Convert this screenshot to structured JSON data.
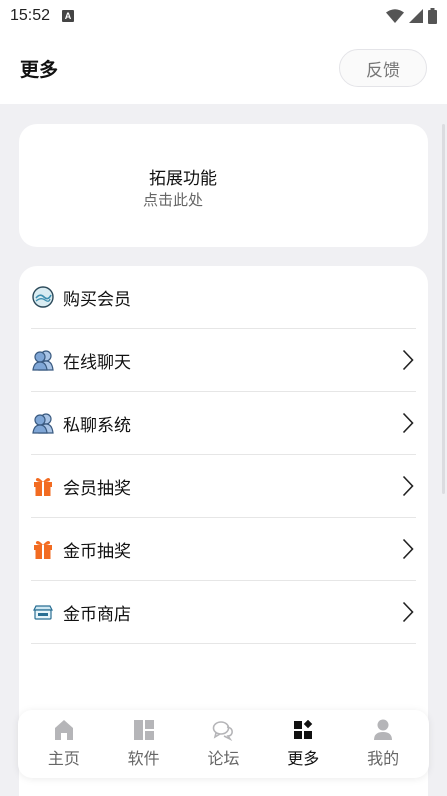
{
  "status_bar": {
    "time": "15:52",
    "notification_glyph": "A"
  },
  "header": {
    "title": "更多",
    "feedback_label": "反馈"
  },
  "extension": {
    "title": "拓展功能",
    "subtitle": "点击此处"
  },
  "menu": {
    "items": [
      {
        "label": "购买会员",
        "icon": "vip-badge-icon",
        "chevron": false
      },
      {
        "label": "在线聊天",
        "icon": "users-icon",
        "chevron": true
      },
      {
        "label": "私聊系统",
        "icon": "users-icon",
        "chevron": true
      },
      {
        "label": "会员抽奖",
        "icon": "gift-icon",
        "chevron": true
      },
      {
        "label": "金币抽奖",
        "icon": "gift-icon",
        "chevron": true
      },
      {
        "label": "金币商店",
        "icon": "store-icon",
        "chevron": true
      }
    ]
  },
  "tabs": [
    {
      "label": "主页",
      "icon": "home-icon",
      "active": false
    },
    {
      "label": "软件",
      "icon": "apps-grid-icon",
      "active": false
    },
    {
      "label": "论坛",
      "icon": "chat-bubbles-icon",
      "active": false
    },
    {
      "label": "更多",
      "icon": "more-grid-icon",
      "active": true
    },
    {
      "label": "我的",
      "icon": "person-icon",
      "active": false
    }
  ],
  "colors": {
    "background": "#f0f0f3",
    "card": "#ffffff",
    "gift_orange": "#f26b21",
    "user_blue": "#7fa6d6",
    "inactive_icon": "#b5b5b8",
    "active_icon": "#111111"
  }
}
